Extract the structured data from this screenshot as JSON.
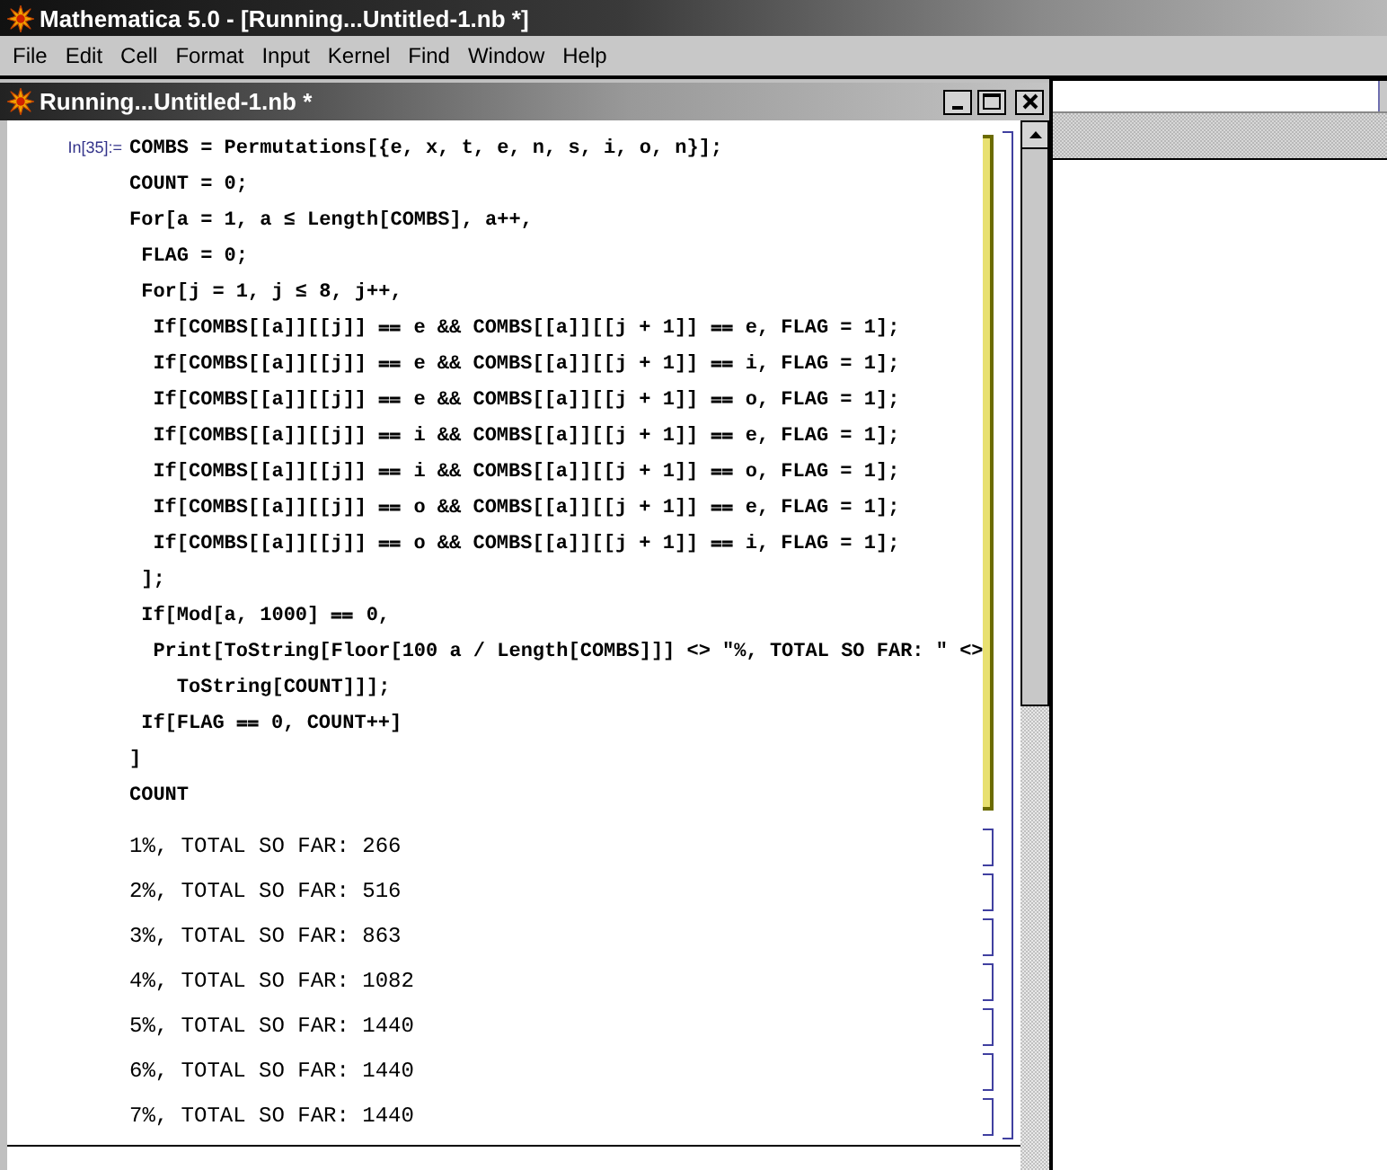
{
  "app_window": {
    "title": "Mathematica 5.0 - [Running...Untitled-1.nb *]"
  },
  "menu": [
    {
      "label": "File"
    },
    {
      "label": "Edit"
    },
    {
      "label": "Cell"
    },
    {
      "label": "Format"
    },
    {
      "label": "Input"
    },
    {
      "label": "Kernel"
    },
    {
      "label": "Find"
    },
    {
      "label": "Window"
    },
    {
      "label": "Help"
    }
  ],
  "notebook": {
    "title": "Running...Untitled-1.nb *",
    "input_cell": {
      "label": "In[35]:=",
      "running": true,
      "lines": [
        "COMBS = Permutations[{e, x, t, e, n, s, i, o, n}];",
        "COUNT = 0;",
        "For[a = 1, a ≤ Length[COMBS], a++,",
        " FLAG = 0;",
        " For[j = 1, j ≤ 8, j++,",
        "  If[COMBS[[a]][[j]] ⩵ e && COMBS[[a]][[j + 1]] ⩵ e, FLAG = 1];",
        "  If[COMBS[[a]][[j]] ⩵ e && COMBS[[a]][[j + 1]] ⩵ i, FLAG = 1];",
        "  If[COMBS[[a]][[j]] ⩵ e && COMBS[[a]][[j + 1]] ⩵ o, FLAG = 1];",
        "  If[COMBS[[a]][[j]] ⩵ i && COMBS[[a]][[j + 1]] ⩵ e, FLAG = 1];",
        "  If[COMBS[[a]][[j]] ⩵ i && COMBS[[a]][[j + 1]] ⩵ o, FLAG = 1];",
        "  If[COMBS[[a]][[j]] ⩵ o && COMBS[[a]][[j + 1]] ⩵ e, FLAG = 1];",
        "  If[COMBS[[a]][[j]] ⩵ o && COMBS[[a]][[j + 1]] ⩵ i, FLAG = 1];",
        " ];",
        " If[Mod[a, 1000] ⩵ 0,",
        "  Print[ToString[Floor[100 a / Length[COMBS]]] <> \"%, TOTAL SO FAR: \" <>",
        "    ToString[COUNT]]];",
        " If[FLAG ⩵ 0, COUNT++]",
        "]",
        "COUNT"
      ]
    },
    "output_cells": [
      "1%, TOTAL SO FAR: 266",
      "2%, TOTAL SO FAR: 516",
      "3%, TOTAL SO FAR: 863",
      "4%, TOTAL SO FAR: 1082",
      "5%, TOTAL SO FAR: 1440",
      "6%, TOTAL SO FAR: 1440",
      "7%, TOTAL SO FAR: 1440"
    ]
  }
}
